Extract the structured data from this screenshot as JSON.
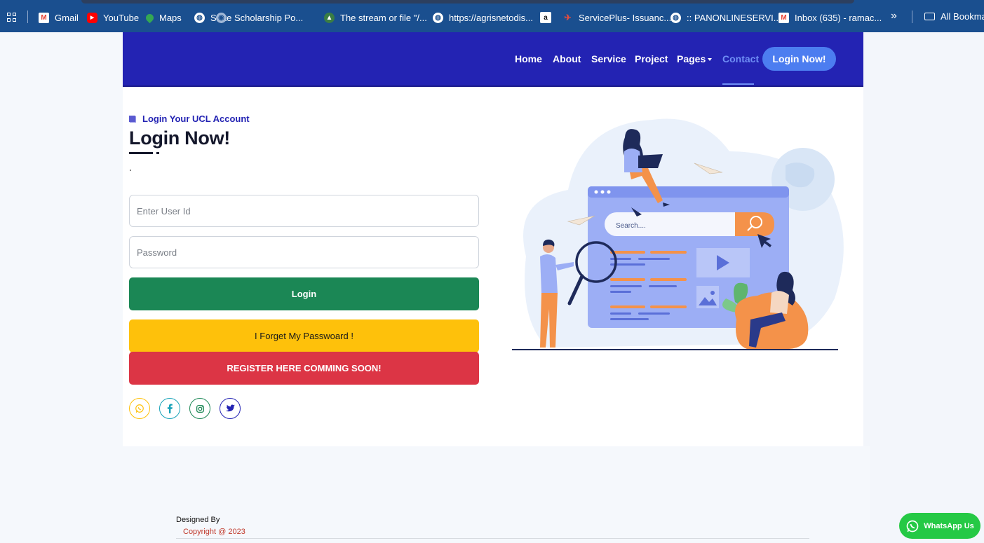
{
  "bookmarks": {
    "items": [
      {
        "label": "Gmail",
        "icon": "gmail-icon",
        "color": "#ea4335"
      },
      {
        "label": "YouTube",
        "icon": "youtube-icon",
        "color": "#ff0000"
      },
      {
        "label": "Maps",
        "icon": "maps-icon",
        "color": "#34a853"
      },
      {
        "label": "State Scholarship Po...",
        "icon": "globe-icon",
        "color": "#ffffff"
      },
      {
        "label": "The stream or file \"/...",
        "icon": "site-icon",
        "color": "#3a7d44"
      },
      {
        "label": "https://agrisnetodis...",
        "icon": "globe-icon",
        "color": "#ffffff"
      },
      {
        "label": "",
        "icon": "amazon-icon",
        "color": "#ffffff"
      },
      {
        "label": "ServicePlus- Issuanc...",
        "icon": "serviceplus-icon",
        "color": "#c0392b"
      },
      {
        "label": ":: PANONLINESERVI...",
        "icon": "globe-icon",
        "color": "#ffffff"
      },
      {
        "label": "Inbox (635) - ramac...",
        "icon": "gmail-icon",
        "color": "#ea4335"
      }
    ],
    "more": "»",
    "all_bookmarks": "All Bookmar"
  },
  "nav": {
    "links": [
      "Home",
      "About",
      "Service",
      "Project",
      "Pages",
      "Contact"
    ],
    "cta": "Login Now!"
  },
  "login": {
    "subtitle": "Login Your UCL Account",
    "title": "Login Now!",
    "user_placeholder": "Enter User Id",
    "password_placeholder": "Password",
    "login_btn": "Login",
    "forget_btn": "I Forget My Passwoard !",
    "register_btn": "REGISTER HERE COMMING SOON!"
  },
  "social": {
    "whatsapp_color": "#fec10b",
    "facebook_color": "#17a2b8",
    "instagram_color": "#1b8755",
    "twitter_color": "#2323b3"
  },
  "illustration": {
    "search_text": "Search...."
  },
  "footer": {
    "designed_by": "Designed By",
    "copyright": "Copyright @ 2023"
  },
  "whatsapp": {
    "label": "WhatsApp Us"
  }
}
